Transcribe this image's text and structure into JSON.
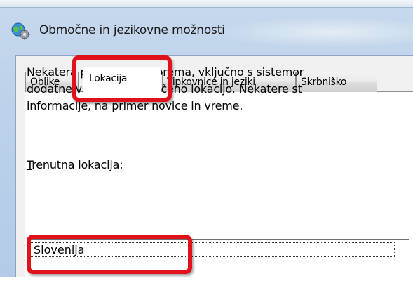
{
  "window": {
    "title": "Območne in jezikovne možnosti",
    "icon": "globe-settings-icon"
  },
  "tabs": [
    {
      "label": "Oblike",
      "active": false
    },
    {
      "label": "Lokacija",
      "active": true
    },
    {
      "label": "Tipkovnice in jeziki",
      "active": false
    },
    {
      "label": "Skrbniško",
      "active": false
    }
  ],
  "panel": {
    "description_lines": [
      "Nekatera programska oprema, vključno s sistemor",
      "dodatne vsebine za določeno lokacijo. Nekatere st",
      "informacije, na primer novice in vreme."
    ],
    "location_label_mnemonic": "T",
    "location_label_rest": "renutna lokacija:",
    "location_value": "Slovenija"
  },
  "colors": {
    "highlight": "#e0111b",
    "window_frame": "#bcd2ea",
    "dialog_bg": "#f0f0f0"
  }
}
